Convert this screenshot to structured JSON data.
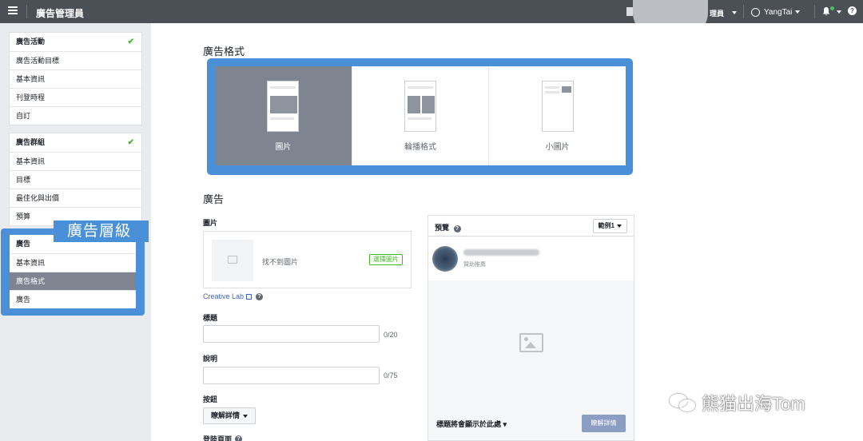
{
  "topbar": {
    "app_title": "廣告管理員",
    "account_label": "理員",
    "user_name": "YangTai"
  },
  "sidebar": {
    "campaign_group": {
      "header": "廣告活動",
      "items": [
        "廣告活動目標",
        "基本資訊",
        "刊登時程",
        "自訂"
      ]
    },
    "adset_group": {
      "header": "廣告群組",
      "items": [
        "基本資訊",
        "目標",
        "最佳化與出價",
        "預算"
      ]
    },
    "ad_group": {
      "header": "廣告",
      "items": [
        "基本資訊",
        "廣告格式",
        "廣告"
      ],
      "active_index": 1
    },
    "ad_level_label": "廣告層級"
  },
  "main": {
    "format_title": "廣告格式",
    "formats": [
      {
        "label": "圖片",
        "selected": true
      },
      {
        "label": "輪播格式",
        "selected": false
      },
      {
        "label": "小圖片",
        "selected": false
      }
    ],
    "ad_title": "廣告",
    "image_label": "圖片",
    "no_image_text": "找不到圖片",
    "select_image_button": "選擇圖片",
    "creative_lab_link": "Creative Lab",
    "headline_label": "標題",
    "headline_count": "0/20",
    "description_label": "說明",
    "description_count": "0/75",
    "button_label": "按鈕",
    "button_value": "瞭解詳情",
    "landing_label": "登陸頁面"
  },
  "preview": {
    "title": "預覽",
    "range_button": "範例1",
    "sponsored_text": "贊助推薦",
    "headline_hint": "標題將會顯示於此處",
    "learn_more_button": "瞭解詳情"
  },
  "watermark": {
    "text": "熊猫出海Tom"
  },
  "colors": {
    "topbar": "#4b4f56",
    "highlight_frame": "#4a90d9",
    "selected_card": "#7f8590",
    "check": "#42b72a"
  }
}
